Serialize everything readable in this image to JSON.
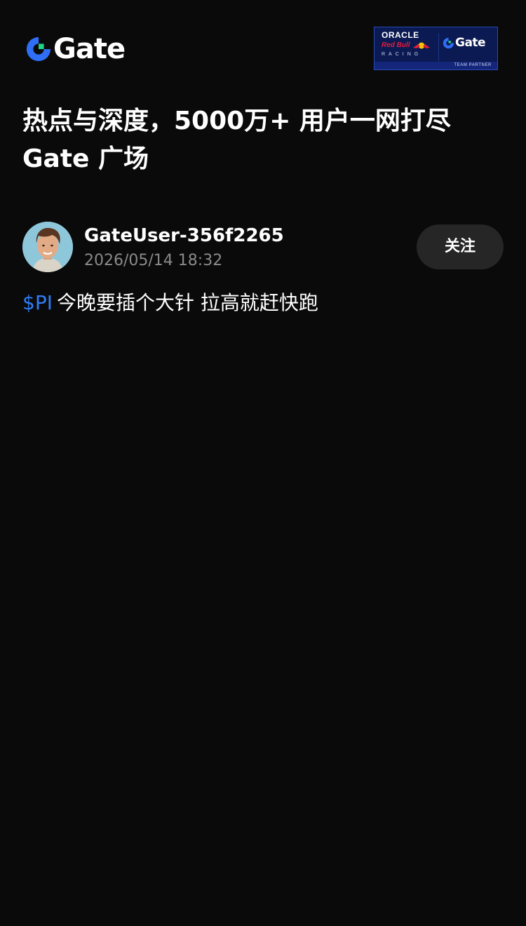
{
  "brand": {
    "logo_text": "Gate",
    "partner_badge": {
      "line1": "ORACLE",
      "line2": "Red Bull",
      "line3": "RACING",
      "gate_text": "Gate",
      "footer": "TEAM PARTNER"
    }
  },
  "headline": "热点与深度，5000万+ 用户一网打尽 Gate 广场",
  "post": {
    "author_name": "GateUser-356f2265",
    "timestamp": "2026/05/14 18:32",
    "follow_label": "关注",
    "ticker": "$PI",
    "body": "今晚要插个大针 拉高就赶快跑"
  },
  "colors": {
    "background": "#0a0a0a",
    "accent_blue": "#2f7cf6",
    "logo_green": "#20d385",
    "muted_text": "#8a8a8a",
    "button_bg": "#262626"
  },
  "icons": {
    "logo": "gate-logo-icon",
    "avatar": "user-avatar"
  }
}
